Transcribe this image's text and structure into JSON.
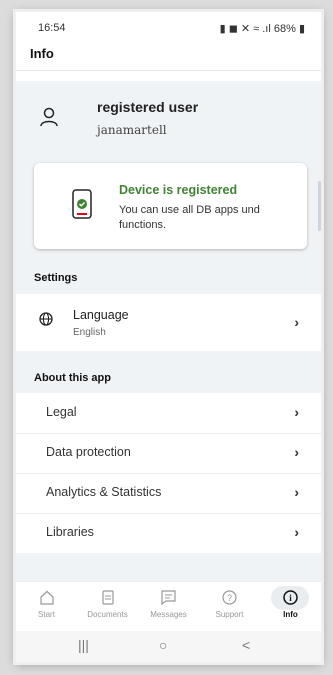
{
  "status": {
    "time": "16:54",
    "battery": "68%"
  },
  "appbar": {
    "title": "Info"
  },
  "user": {
    "name": "registered user",
    "login": "janamartell"
  },
  "device": {
    "title": "Device is registered",
    "body": "You can use all DB apps und functions.",
    "color": "#408335"
  },
  "settings": {
    "header": "Settings",
    "language_label": "Language",
    "language_value": "English"
  },
  "about": {
    "header": "About this app",
    "items": [
      {
        "label": "Legal"
      },
      {
        "label": "Data protection"
      },
      {
        "label": "Analytics & Statistics"
      },
      {
        "label": "Libraries"
      }
    ]
  },
  "tabs": [
    {
      "label": "Start",
      "icon": "home-icon"
    },
    {
      "label": "Documents",
      "icon": "document-icon"
    },
    {
      "label": "Messages",
      "icon": "message-icon"
    },
    {
      "label": "Support",
      "icon": "help-icon"
    },
    {
      "label": "Info",
      "icon": "info-icon",
      "active": true
    }
  ],
  "chevron": "›",
  "navbar": {
    "recents": "|||",
    "home": "○",
    "back": "<"
  }
}
